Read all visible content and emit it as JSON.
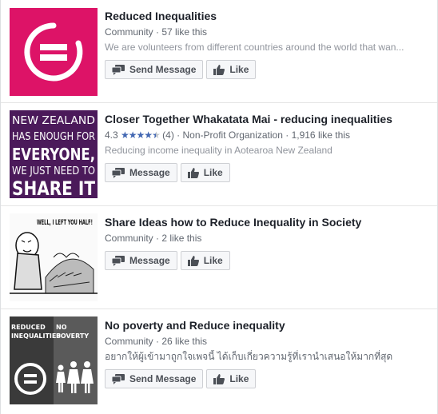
{
  "results": [
    {
      "title": "Reduced Inequalities",
      "category": "Community",
      "likes": "57 like this",
      "description": "We are volunteers from different countries around the world that wan...",
      "buttons": {
        "message": "Send Message",
        "like": "Like"
      },
      "thumb": {
        "type": "logo",
        "bg": "#dd1367"
      }
    },
    {
      "title": "Closer Together Whakatata Mai - reducing inequalities",
      "rating": "4.3",
      "rating_count": "(4)",
      "category": "Non-Profit Organization",
      "likes": "1,916 like this",
      "description": "Reducing income inequality in Aotearoa New Zealand",
      "buttons": {
        "message": "Message",
        "like": "Like"
      },
      "thumb": {
        "type": "text",
        "bg": "#4b1a5a",
        "lines": [
          "NEW ZEALAND",
          "HAS ENOUGH FOR",
          "EVERYONE,",
          "WE JUST NEED TO",
          "SHARE IT"
        ]
      }
    },
    {
      "title": "Share Ideas how to Reduce Inequality in Society",
      "category": "Community",
      "likes": "2 like this",
      "buttons": {
        "message": "Message",
        "like": "Like"
      },
      "thumb": {
        "type": "cartoon",
        "caption": "WELL, I LEFT YOU HALF!"
      }
    },
    {
      "title": "No poverty and Reduce inequality",
      "category": "Community",
      "likes": "26 like this",
      "description": "อยากให้ผู้เข้ามาถูกใจเพจนี้ ได้เก็บเกี่ยวความรู้ที่เรานำเสนอให้มากที่สุด",
      "buttons": {
        "message": "Send Message",
        "like": "Like"
      },
      "thumb": {
        "type": "combo",
        "left_label": "REDUCED INEQUALITIES",
        "right_label": "NO POVERTY"
      }
    }
  ],
  "colors": {
    "accent": "#4267b2",
    "pink": "#dd1367"
  },
  "icons": {
    "message": "message-icon",
    "like": "thumbs-up-icon"
  }
}
